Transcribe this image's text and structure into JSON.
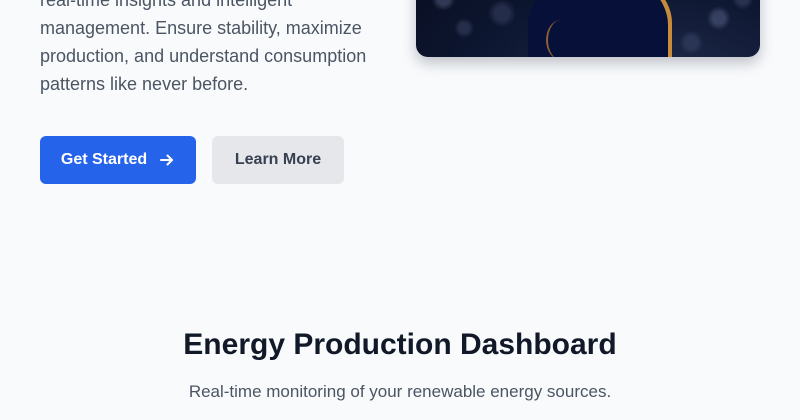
{
  "hero": {
    "description_lines": [
      "real-time insights and intelligent",
      "management. Ensure stability, maximize",
      "production, and understand consumption",
      "patterns like never before."
    ],
    "image_icon": "hero-photo",
    "primary_button": {
      "label": "Get Started",
      "icon": "arrow-right-icon",
      "color": "#2563eb"
    },
    "secondary_button": {
      "label": "Learn More",
      "color": "#e5e7eb"
    }
  },
  "dashboard": {
    "title": "Energy Production Dashboard",
    "subtitle": "Real-time monitoring of your renewable energy sources."
  }
}
